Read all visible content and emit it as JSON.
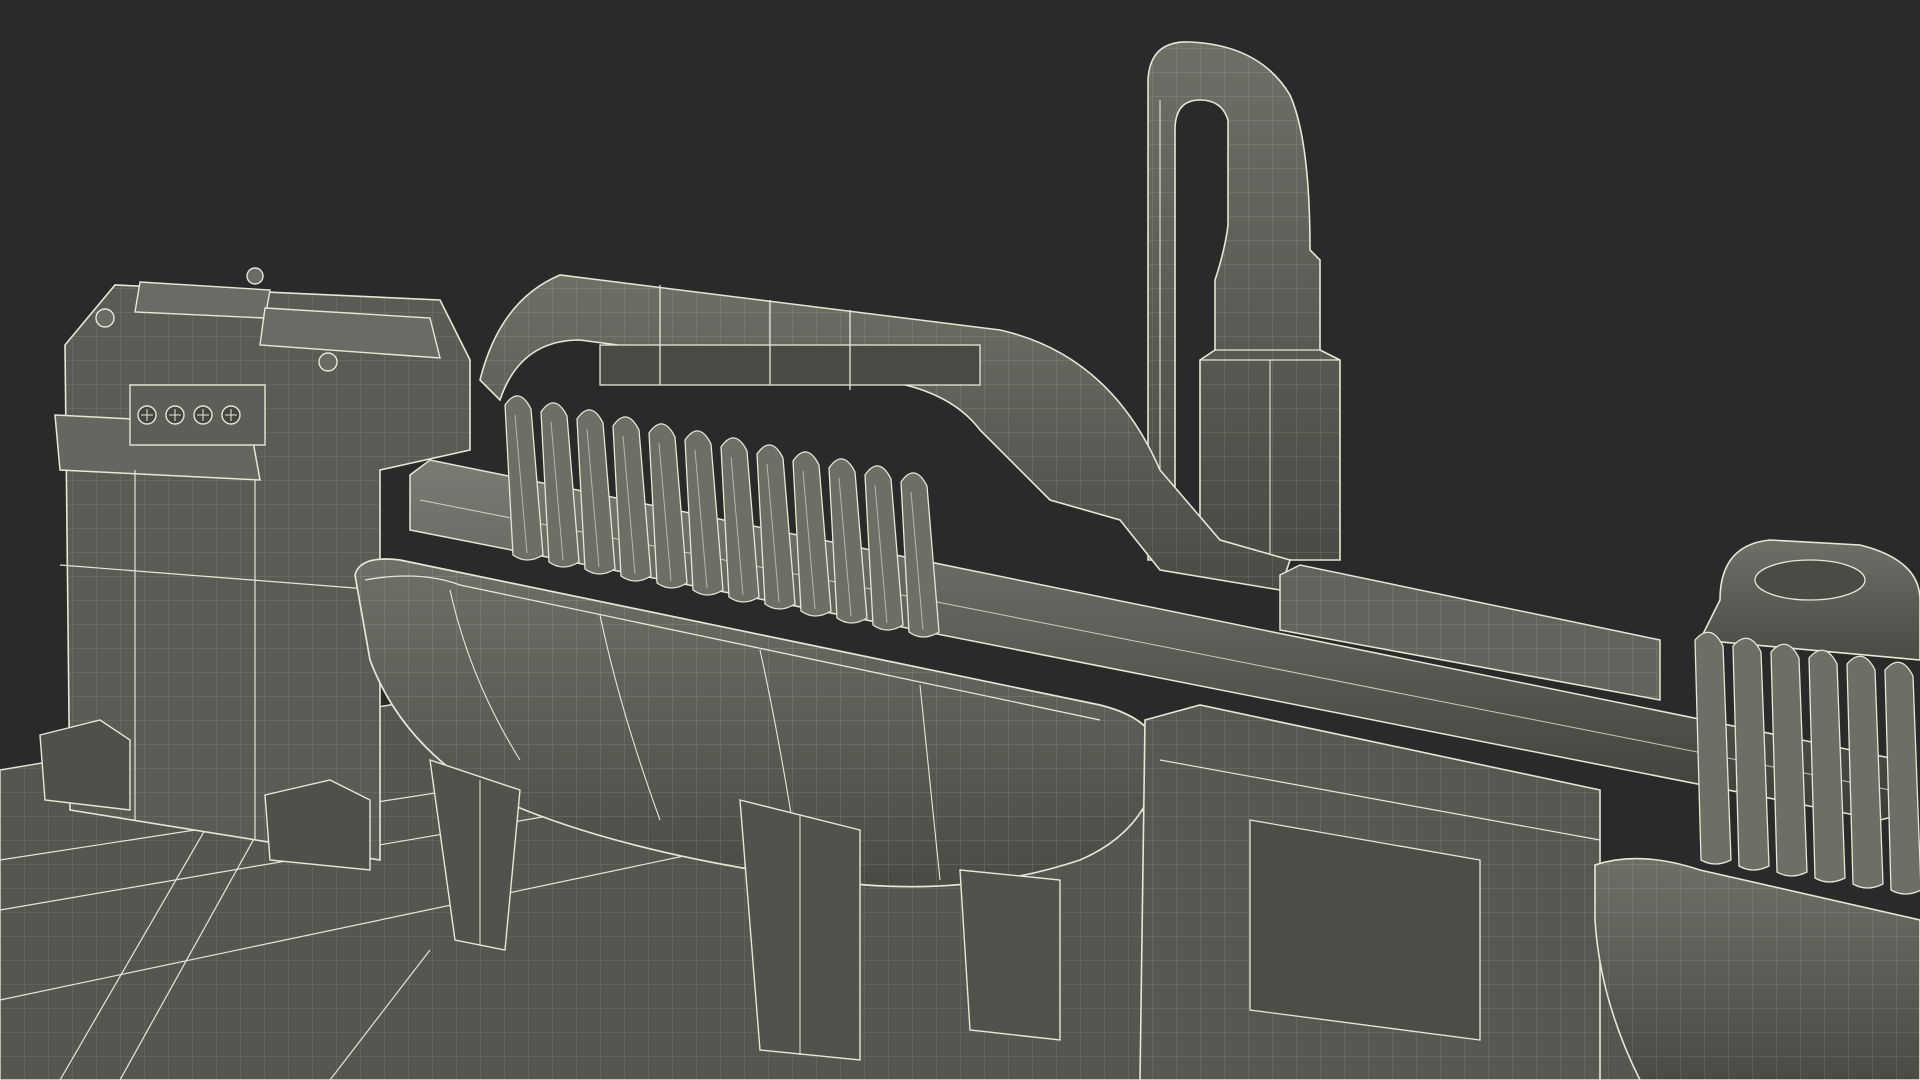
{
  "scene": {
    "background_color": "#2a2a2a",
    "surface_color": "#5b5c55",
    "surface_light": "#6d6e66",
    "surface_dark": "#45463f",
    "wire_color": "#e9e6d4",
    "wire_dim": "#b9b6a6",
    "blade_count_left": 12,
    "blade_count_right": 6,
    "indicator_dots": 4
  }
}
